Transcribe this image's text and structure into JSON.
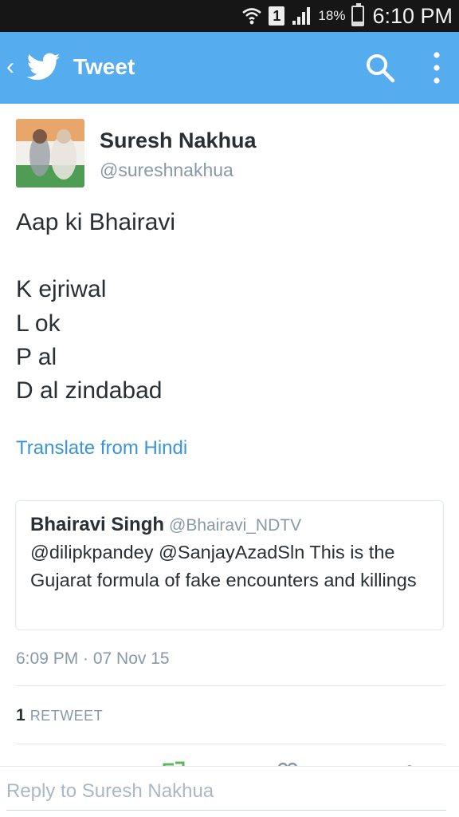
{
  "status_bar": {
    "sim_slot": "1",
    "battery_percent": "18%",
    "battery_level": 0.18,
    "time": "6:10 PM",
    "icons": [
      "wifi-icon",
      "sim-icon",
      "signal-icon",
      "battery-icon"
    ]
  },
  "action_bar": {
    "title": "Tweet",
    "icons": [
      "back-chevron-icon",
      "twitter-bird-icon",
      "search-icon",
      "overflow-menu-icon"
    ],
    "background": "#55acee"
  },
  "tweet": {
    "author_name": "Suresh Nakhua",
    "author_handle": "@sureshnakhua",
    "text_lines": [
      "Aap ki Bhairavi",
      "",
      "K ejriwal",
      "L ok",
      "P al",
      "D al zindabad"
    ],
    "translate_label": "Translate from Hindi",
    "quoted": {
      "name": "Bhairavi Singh",
      "handle": "@Bhairavi_NDTV",
      "text": "@dilipkpandey @SanjayAzadSln This is the Gujarat formula of fake encounters and killings"
    },
    "timestamp": "6:09 PM · 07 Nov 15",
    "retweet_count": "1",
    "retweet_label": "RETWEET"
  },
  "reply": {
    "placeholder": "Reply to Suresh Nakhua",
    "value": ""
  },
  "colors": {
    "accent": "#55acee",
    "link": "#3b94d9",
    "muted": "#8899a6",
    "text": "#292f33"
  }
}
